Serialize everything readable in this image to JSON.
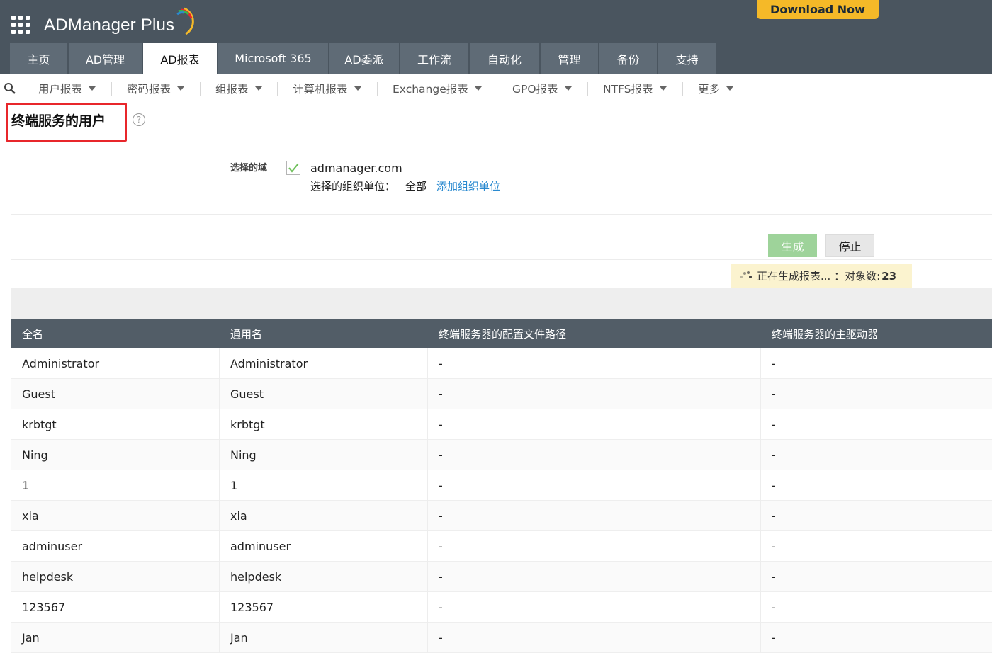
{
  "header": {
    "app_name": "ADManager Plus",
    "download_label": "Download Now",
    "tabs": [
      {
        "label": "主页"
      },
      {
        "label": "AD管理"
      },
      {
        "label": "AD报表"
      },
      {
        "label": "Microsoft 365"
      },
      {
        "label": "AD委派"
      },
      {
        "label": "工作流"
      },
      {
        "label": "自动化"
      },
      {
        "label": "管理"
      },
      {
        "label": "备份"
      },
      {
        "label": "支持"
      }
    ],
    "active_tab": "AD报表"
  },
  "subnav": {
    "items": [
      {
        "label": "用户报表"
      },
      {
        "label": "密码报表"
      },
      {
        "label": "组报表"
      },
      {
        "label": "计算机报表"
      },
      {
        "label": "Exchange报表"
      },
      {
        "label": "GPO报表"
      },
      {
        "label": "NTFS报表"
      },
      {
        "label": "更多"
      }
    ]
  },
  "page": {
    "title": "终端服务的用户",
    "help_icon": "question-circle-icon"
  },
  "domain_section": {
    "label": "选择的域",
    "domain": "admanager.com",
    "domain_checked": true,
    "ou_label": "选择的组织单位：",
    "ou_value": "全部",
    "add_ou_link": "添加组织单位"
  },
  "actions": {
    "generate_label": "生成",
    "stop_label": "停止"
  },
  "status": {
    "text": "正在生成报表... ：对象数:",
    "count": "23"
  },
  "table": {
    "columns": [
      "全名",
      "通用名",
      "终端服务器的配置文件路径",
      "终端服务器的主驱动器"
    ],
    "rows": [
      [
        "Administrator",
        "Administrator",
        "-",
        "-"
      ],
      [
        "Guest",
        "Guest",
        "-",
        "-"
      ],
      [
        "krbtgt",
        "krbtgt",
        "-",
        "-"
      ],
      [
        "Ning",
        "Ning",
        "-",
        "-"
      ],
      [
        "1",
        "1",
        "-",
        "-"
      ],
      [
        "xia",
        "xia",
        "-",
        "-"
      ],
      [
        "adminuser",
        "adminuser",
        "-",
        "-"
      ],
      [
        "helpdesk",
        "helpdesk",
        "-",
        "-"
      ],
      [
        "123567",
        "123567",
        "-",
        "-"
      ],
      [
        "Jan",
        "Jan",
        "-",
        "-"
      ]
    ]
  },
  "colors": {
    "header_bg": "#4a555f",
    "tab_bg": "#5f6b76",
    "download_bg": "#f5b928",
    "generate_bg": "#9ed39a",
    "status_bg": "#fbf3cf",
    "highlight_border": "#e8262b",
    "link": "#2a8ad0",
    "table_header_bg": "#525d67"
  }
}
